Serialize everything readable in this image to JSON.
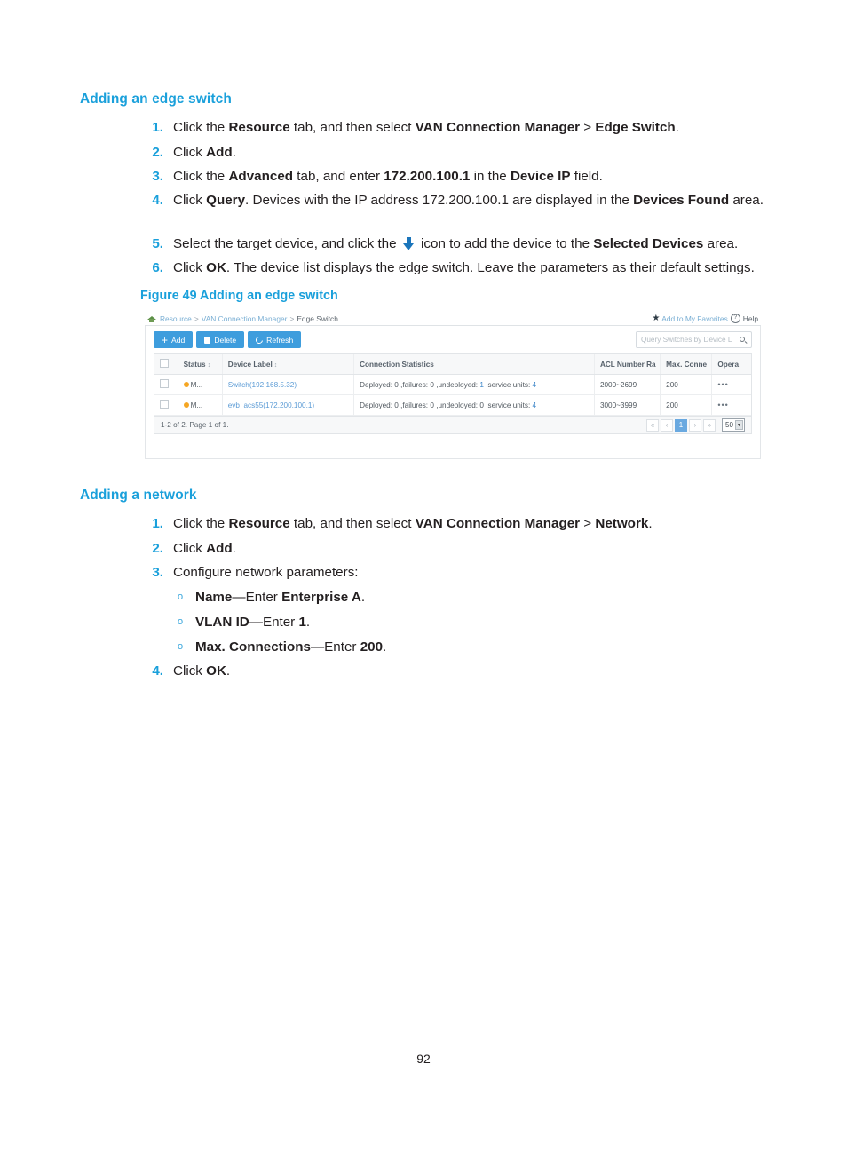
{
  "sections": [
    {
      "heading": "Adding an edge switch",
      "steps": [
        {
          "num": "1.",
          "html": "Click the <b>Resource</b> tab, and then select <b>VAN Connection Manager</b> &gt; <b>Edge Switch</b>."
        },
        {
          "num": "2.",
          "html": "Click <b>Add</b>."
        },
        {
          "num": "3.",
          "html": "Click the <b>Advanced</b> tab, and enter <b>172.200.100.1</b> in the <b>Device IP</b> field."
        },
        {
          "num": "4.",
          "html": "Click <b>Query</b>. Devices with the IP address 172.200.100.1 are displayed in the <b>Devices Found</b> area."
        },
        {
          "num": "5.",
          "html": "Select the target device, and click the <span class=\"down-arrow-icon\" data-name=\"down-arrow-icon\" data-interactable=\"false\"></span> icon to add the device to the <b>Selected Devices</b> area."
        },
        {
          "num": "6.",
          "html": "Click <b>OK</b>. The device list displays the edge switch. Leave the parameters as their default settings."
        }
      ]
    },
    {
      "heading": "Adding a network",
      "steps": [
        {
          "num": "1.",
          "html": "Click the <b>Resource</b> tab, and then select <b>VAN Connection Manager</b> &gt; <b>Network</b>."
        },
        {
          "num": "2.",
          "html": "Click <b>Add</b>."
        },
        {
          "num": "3.",
          "html": "Configure network parameters:"
        }
      ],
      "substeps": [
        {
          "marker": "o",
          "html": "<b>Name</b>—Enter <b>Enterprise A</b>."
        },
        {
          "marker": "o",
          "html": "<b>VLAN ID</b>—Enter <b>1</b>."
        },
        {
          "marker": "o",
          "html": "<b>Max. Connections</b>—Enter <b>200</b>."
        }
      ],
      "final_step": {
        "num": "4.",
        "html": "Click <b>OK</b>."
      }
    }
  ],
  "figure": {
    "caption": "Figure 49 Adding an edge switch",
    "breadcrumb": {
      "home_icon": "house-icon",
      "items": [
        "Resource",
        "VAN Connection Manager"
      ],
      "separator": ">",
      "current": "Edge Switch",
      "favorites_label": "Add to My Favorites",
      "favorites_icon": "star-icon",
      "help_label": "Help",
      "help_icon": "question-mark-icon"
    },
    "toolbar": {
      "buttons": [
        {
          "label": "Add",
          "icon": "plus-icon"
        },
        {
          "label": "Delete",
          "icon": "trash-icon"
        },
        {
          "label": "Refresh",
          "icon": "refresh-icon"
        }
      ],
      "search_placeholder": "Query Switches by Device L",
      "search_value": "",
      "search_icon": "magnifier-icon"
    },
    "table": {
      "columns": [
        {
          "key": "checkbox",
          "label": "",
          "sortable": false
        },
        {
          "key": "status",
          "label": "Status",
          "sortable": true
        },
        {
          "key": "device_label",
          "label": "Device Label",
          "sortable": true
        },
        {
          "key": "connection_statistics",
          "label": "Connection Statistics",
          "sortable": false
        },
        {
          "key": "acl_number_range",
          "label": "ACL Number Ra",
          "sortable": false
        },
        {
          "key": "max_connections",
          "label": "Max. Conne",
          "sortable": false
        },
        {
          "key": "operation",
          "label": "Opera",
          "sortable": false
        }
      ],
      "rows": [
        {
          "status": "M...",
          "status_color": "#f5a623",
          "device_label": "Switch(192.168.5.32)",
          "conn_deployed_label": "Deployed: ",
          "conn_deployed": "0",
          "conn_failures_label": " ,failures: ",
          "conn_failures": "0",
          "conn_undeployed_label": " ,undeployed: ",
          "conn_undeployed": "1",
          "conn_units_label": " ,service units: ",
          "conn_units": "4",
          "acl_number_range": "2000~2699",
          "max_connections": "200",
          "operation": "•••"
        },
        {
          "status": "M...",
          "status_color": "#f5a623",
          "device_label": "evb_acs55(172.200.100.1)",
          "conn_deployed_label": "Deployed: ",
          "conn_deployed": "0",
          "conn_failures_label": " ,failures: ",
          "conn_failures": "0",
          "conn_undeployed_label": " ,undeployed: ",
          "conn_undeployed": "0",
          "conn_units_label": " ,service units: ",
          "conn_units": "4",
          "acl_number_range": "3000~3999",
          "max_connections": "200",
          "operation": "•••"
        }
      ]
    },
    "pagination": {
      "info": "1-2 of 2. Page 1 of 1.",
      "first": "«",
      "prev": "‹",
      "current_page": "1",
      "next": "›",
      "last": "»",
      "page_size": "50"
    }
  },
  "page_number": "92"
}
